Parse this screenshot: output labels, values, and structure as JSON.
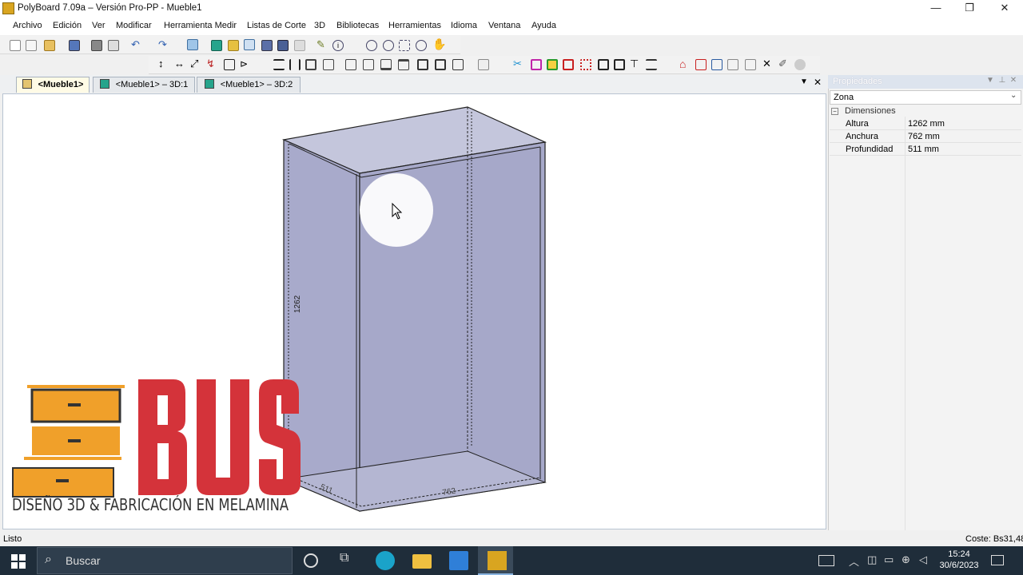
{
  "window": {
    "title": "PolyBoard 7.09a – Versión Pro-PP - Mueble1",
    "minimize": "—",
    "restore": "❐",
    "close": "✕"
  },
  "menu": [
    "Archivo",
    "Edición",
    "Ver",
    "Modificar",
    "Herramienta Medir",
    "Listas de Corte",
    "3D",
    "Bibliotecas",
    "Herramientas",
    "Idioma",
    "Ventana",
    "Ayuda"
  ],
  "tabs": [
    {
      "label": "<Mueble1>",
      "active": true,
      "icon": "cabinet-2d-icon"
    },
    {
      "label": "<Mueble1> – 3D:1",
      "active": false,
      "icon": "cube-3d-icon"
    },
    {
      "label": "<Mueble1> – 3D:2",
      "active": false,
      "icon": "cube-3d-icon"
    }
  ],
  "viewport": {
    "dim_height": "1262",
    "dim_depth": "511",
    "dim_width": "762"
  },
  "logo": {
    "word": "BUS",
    "tagline": "DISEÑO 3D & FABRICACIÓN EN MELAMINA"
  },
  "properties": {
    "title": "Propiedades",
    "zone": "Zona",
    "group": "Dimensiones",
    "rows": [
      {
        "name": "Altura",
        "value": "1262 mm"
      },
      {
        "name": "Anchura",
        "value": "762 mm"
      },
      {
        "name": "Profundidad",
        "value": "511 mm"
      }
    ]
  },
  "status": {
    "left": "Listo",
    "right": "Coste: Bs31,48"
  },
  "taskbar": {
    "search_placeholder": "Buscar",
    "time": "15:24",
    "date": "30/6/2023"
  },
  "colors": {
    "panel_fill": "#a8aacb",
    "logo_red": "#d4333a",
    "logo_orange": "#f0a02a",
    "cursor_highlight": "#ffffff"
  }
}
